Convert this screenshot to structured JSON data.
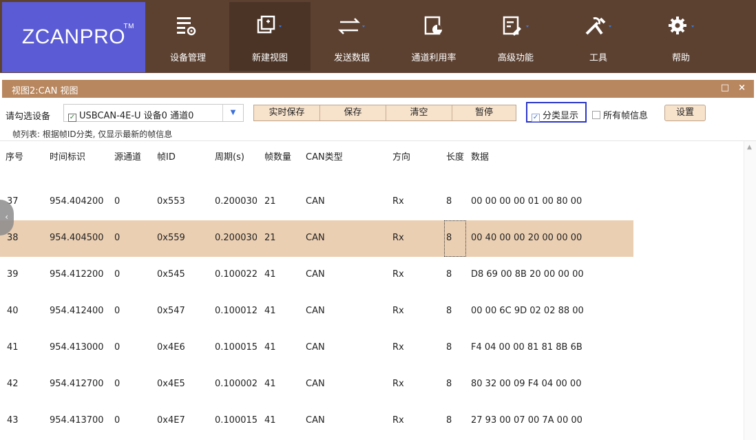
{
  "app": {
    "logo": "ZCANPRO",
    "tm": "TM"
  },
  "toolbar": [
    {
      "label": "设备管理",
      "icon": "device-manage-icon",
      "caret": false
    },
    {
      "label": "新建视图",
      "icon": "new-view-icon",
      "caret": true
    },
    {
      "label": "发送数据",
      "icon": "send-data-icon",
      "caret": true
    },
    {
      "label": "通道利用率",
      "icon": "channel-usage-icon",
      "caret": false
    },
    {
      "label": "高级功能",
      "icon": "advanced-icon",
      "caret": true
    },
    {
      "label": "工具",
      "icon": "tools-icon",
      "caret": true
    },
    {
      "label": "帮助",
      "icon": "gear-icon",
      "caret": true
    }
  ],
  "view": {
    "title": "视图2:CAN 视图",
    "restore": "□",
    "close": "×"
  },
  "controls": {
    "device_label": "请勾选设备",
    "device_value": "USBCAN-4E-U 设备0 通道0",
    "buttons": [
      "实时保存",
      "保存",
      "清空",
      "暂停"
    ],
    "classify_label": "分类显示",
    "all_frames_label": "所有帧信息",
    "settings_label": "设置"
  },
  "info_text": "帧列表: 根据帧ID分类, 仅显示最新的帧信息",
  "table": {
    "headers": [
      "序号",
      "时间标识",
      "源通道",
      "帧ID",
      "周期(s)",
      "帧数量",
      "CAN类型",
      "方向",
      "长度",
      "数据"
    ],
    "rows": [
      [
        "37",
        "954.404200",
        "0",
        "0x553",
        "0.200030",
        "21",
        "CAN",
        "Rx",
        "8",
        "00 00 00 00 01 00 80 00"
      ],
      [
        "38",
        "954.404500",
        "0",
        "0x559",
        "0.200030",
        "21",
        "CAN",
        "Rx",
        "8",
        "00 40 00 00 20 00 00 00"
      ],
      [
        "39",
        "954.412200",
        "0",
        "0x545",
        "0.100022",
        "41",
        "CAN",
        "Rx",
        "8",
        "D8 69 00 8B 20 00 00 00"
      ],
      [
        "40",
        "954.412400",
        "0",
        "0x547",
        "0.100012",
        "41",
        "CAN",
        "Rx",
        "8",
        "00 00 6C 9D 02 02 88 00"
      ],
      [
        "41",
        "954.413000",
        "0",
        "0x4E6",
        "0.100015",
        "41",
        "CAN",
        "Rx",
        "8",
        "F4 04 00 00 81 81 8B 6B"
      ],
      [
        "42",
        "954.412700",
        "0",
        "0x4E5",
        "0.100002",
        "41",
        "CAN",
        "Rx",
        "8",
        "80 32 00 09 F4 04 00 00"
      ],
      [
        "43",
        "954.413700",
        "0",
        "0x4E7",
        "0.100015",
        "41",
        "CAN",
        "Rx",
        "8",
        "27 93 00 07 00 7A 00 00"
      ]
    ]
  }
}
